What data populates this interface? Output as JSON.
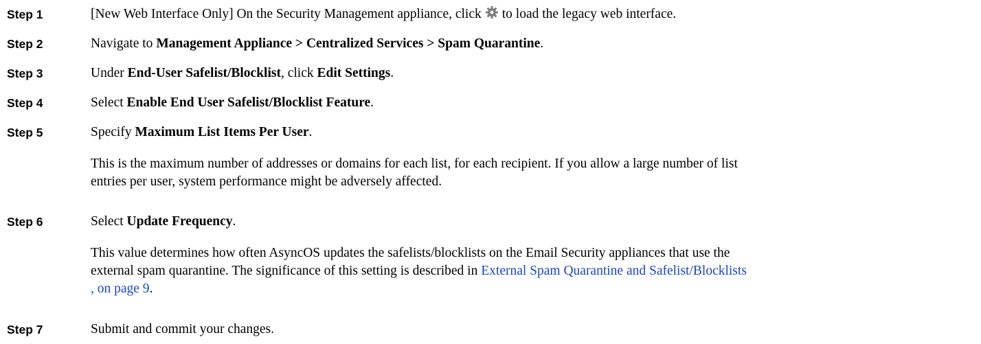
{
  "steps": [
    {
      "label": "Step 1",
      "t1": "[New Web Interface Only] On the Security Management appliance, click",
      "icon": "gear-icon",
      "t2": "to load the legacy web interface."
    },
    {
      "label": "Step 2",
      "t1": "Navigate to ",
      "b1": "Management Appliance > Centralized Services > Spam Quarantine",
      "t2": "."
    },
    {
      "label": "Step 3",
      "t1": "Under ",
      "b1": "End-User Safelist/Blocklist",
      "t2": ", click ",
      "b2": "Edit Settings",
      "t3": "."
    },
    {
      "label": "Step 4",
      "t1": "Select ",
      "b1": "Enable End User Safelist/Blocklist Feature",
      "t2": "."
    },
    {
      "label": "Step 5",
      "t1": "Specify ",
      "b1": "Maximum List Items Per User",
      "t2": ".",
      "p1": "This is the maximum number of addresses or domains for each list, for each recipient. If you allow a large number of list",
      "p2": "entries per user, system performance might be adversely affected."
    },
    {
      "label": "Step 6",
      "t1": "Select ",
      "b1": "Update Frequency",
      "t2": ".",
      "p1": "This value determines how often AsyncOS updates the safelists/blocklists on the Email Security appliances that use the",
      "p2": "external spam quarantine. The significance of this setting is described in ",
      "link1": "External Spam Quarantine and Safelist/Blocklists",
      "link2": ", on page 9",
      "p3": "."
    },
    {
      "label": "Step 7",
      "t1": "Submit and commit your changes."
    }
  ]
}
